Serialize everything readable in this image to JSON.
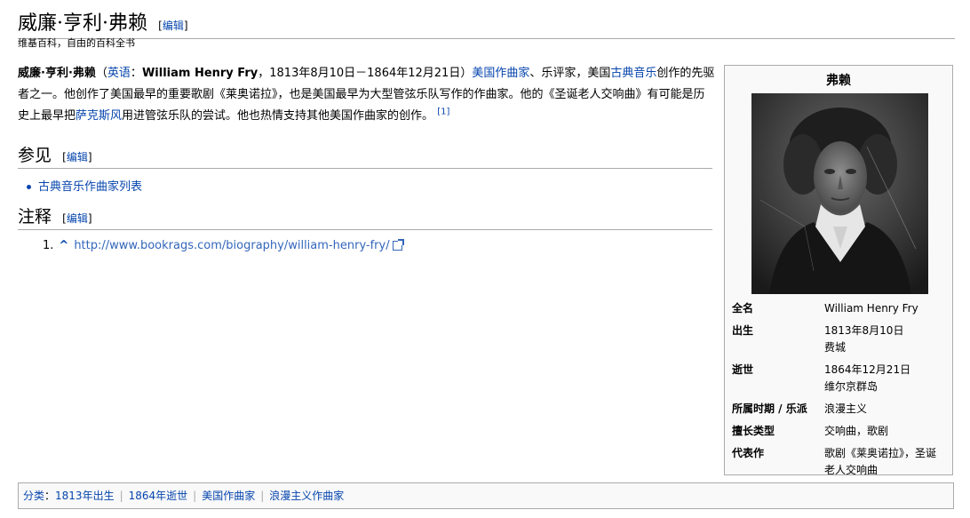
{
  "page": {
    "title": "威廉·亨利·弗赖",
    "edit_label": "编辑",
    "tagline": "维基百科，自由的百科全书"
  },
  "intro": {
    "name_bold": "威廉·亨利·弗赖",
    "paren_open": "（",
    "lang_link": "英语",
    "colon": "：",
    "en_name": "William Henry Fry",
    "dates": "，1813年8月10日－1864年12月21日）",
    "comma": "，",
    "link_us_composer": "美国作曲家",
    "text1": "、乐评家，美国",
    "link_classical": "古典音乐",
    "text2": "创作的先驱者之一。他创作了美国最早的重要歌剧《莱奥诺拉》，也是美国最早为大型管弦乐队写作的作曲家。他的《圣诞老人交响曲》有可能是历史上最早把",
    "link_sax": "萨克斯风",
    "text3": "用进管弦乐队的尝试。他也热情支持其他美国作曲家的创作。",
    "ref": "[1]"
  },
  "see_also": {
    "heading": "参见",
    "items": [
      "古典音乐作曲家列表"
    ]
  },
  "notes": {
    "heading": "注释",
    "items": [
      {
        "num": "1.",
        "caret": "^",
        "url": "http://www.bookrags.com/biography/william-henry-fry/"
      }
    ]
  },
  "infobox": {
    "title": "弗赖",
    "rows": [
      {
        "key": "全名",
        "value": "William Henry Fry"
      },
      {
        "key": "出生",
        "value": "1813年8月10日",
        "value2": "费城"
      },
      {
        "key": "逝世",
        "value": "1864年12月21日",
        "value2": "维尔京群岛"
      },
      {
        "key": "所属时期 / 乐派",
        "value": "浪漫主义"
      },
      {
        "key": "擅长类型",
        "value": "交响曲，歌剧"
      },
      {
        "key": "代表作",
        "value": "歌剧《莱奥诺拉》，圣诞",
        "value2": "老人交响曲"
      }
    ]
  },
  "categories": {
    "label": "分类",
    "colon": "：",
    "items": [
      "1813年出生",
      "1864年逝世",
      "美国作曲家",
      "浪漫主义作曲家"
    ]
  }
}
